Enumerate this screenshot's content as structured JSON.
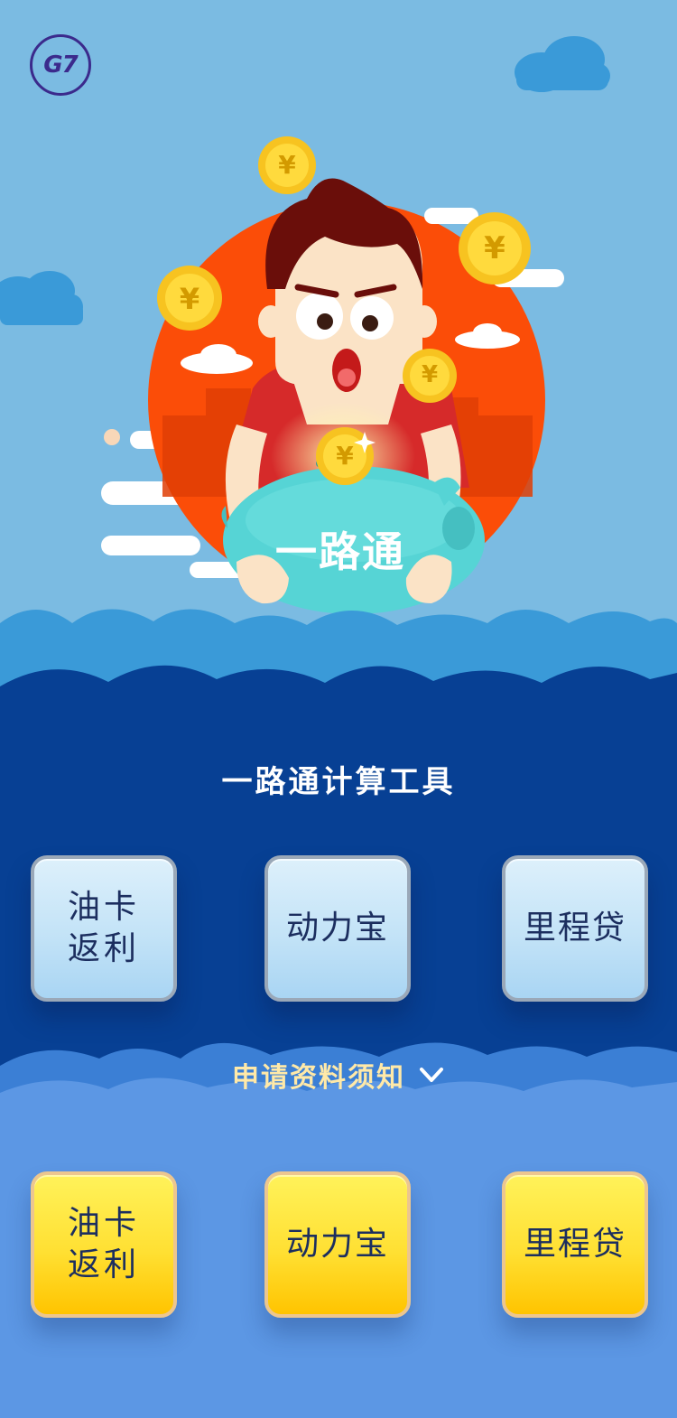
{
  "logo": {
    "text": "G7"
  },
  "hero": {
    "banner_text": "一路通",
    "coin_symbol": "¥"
  },
  "tools_section": {
    "title": "一路通计算工具",
    "buttons": [
      {
        "label": "油卡返利"
      },
      {
        "label": "动力宝"
      },
      {
        "label": "里程贷"
      }
    ]
  },
  "notice": {
    "label": "申请资料须知",
    "icon": "chevron-down-icon"
  },
  "materials_section": {
    "buttons": [
      {
        "label": "油卡返利"
      },
      {
        "label": "动力宝"
      },
      {
        "label": "里程贷"
      }
    ]
  },
  "colors": {
    "sky": "#7bbbe2",
    "navy": "#074094",
    "mid_blue": "#5c97e4",
    "sun": "#fb4d08",
    "coin": "#f7c320",
    "piggy": "#56d4d5",
    "yellow_button": "#ffe033",
    "blue_button": "#c3e3f7",
    "notice_text": "#ffe9a8"
  }
}
